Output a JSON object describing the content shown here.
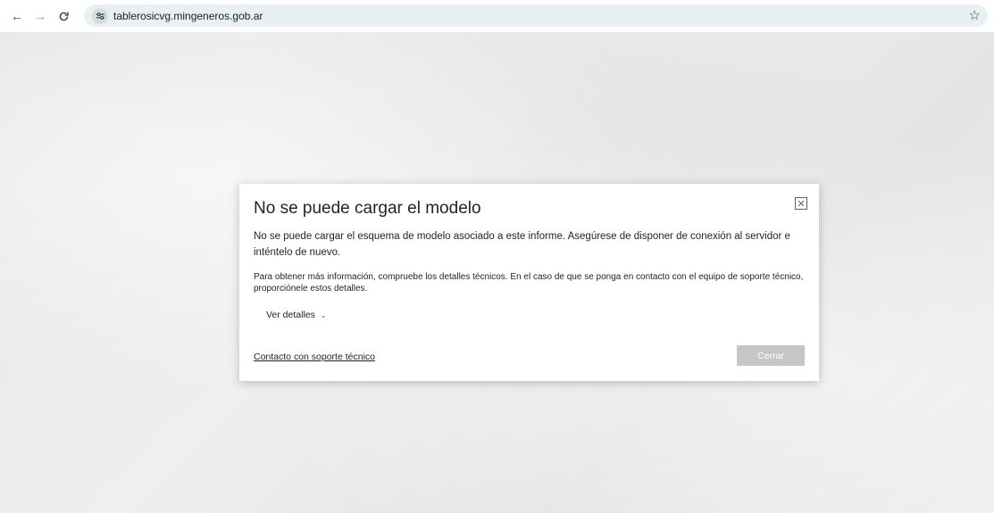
{
  "browser": {
    "url": "tablerosicvg.mingeneros.gob.ar",
    "back_icon": "←",
    "forward_icon": "→",
    "reload_icon": "C",
    "bookmark_icon": "☆"
  },
  "dialog": {
    "title": "No se puede cargar el modelo",
    "message": "No se puede cargar el esquema de modelo asociado a este informe. Asegúrese de disponer de conexión al servidor e inténtelo de nuevo.",
    "note": "Para obtener más información, compruebe los detalles técnicos. En el caso de que se ponga en contacto con el equipo de soporte técnico, proporciónele estos detalles.",
    "details_label": "Ver detalles",
    "support_link": "Contacto con soporte técnico",
    "close_button": "Cerrar"
  }
}
